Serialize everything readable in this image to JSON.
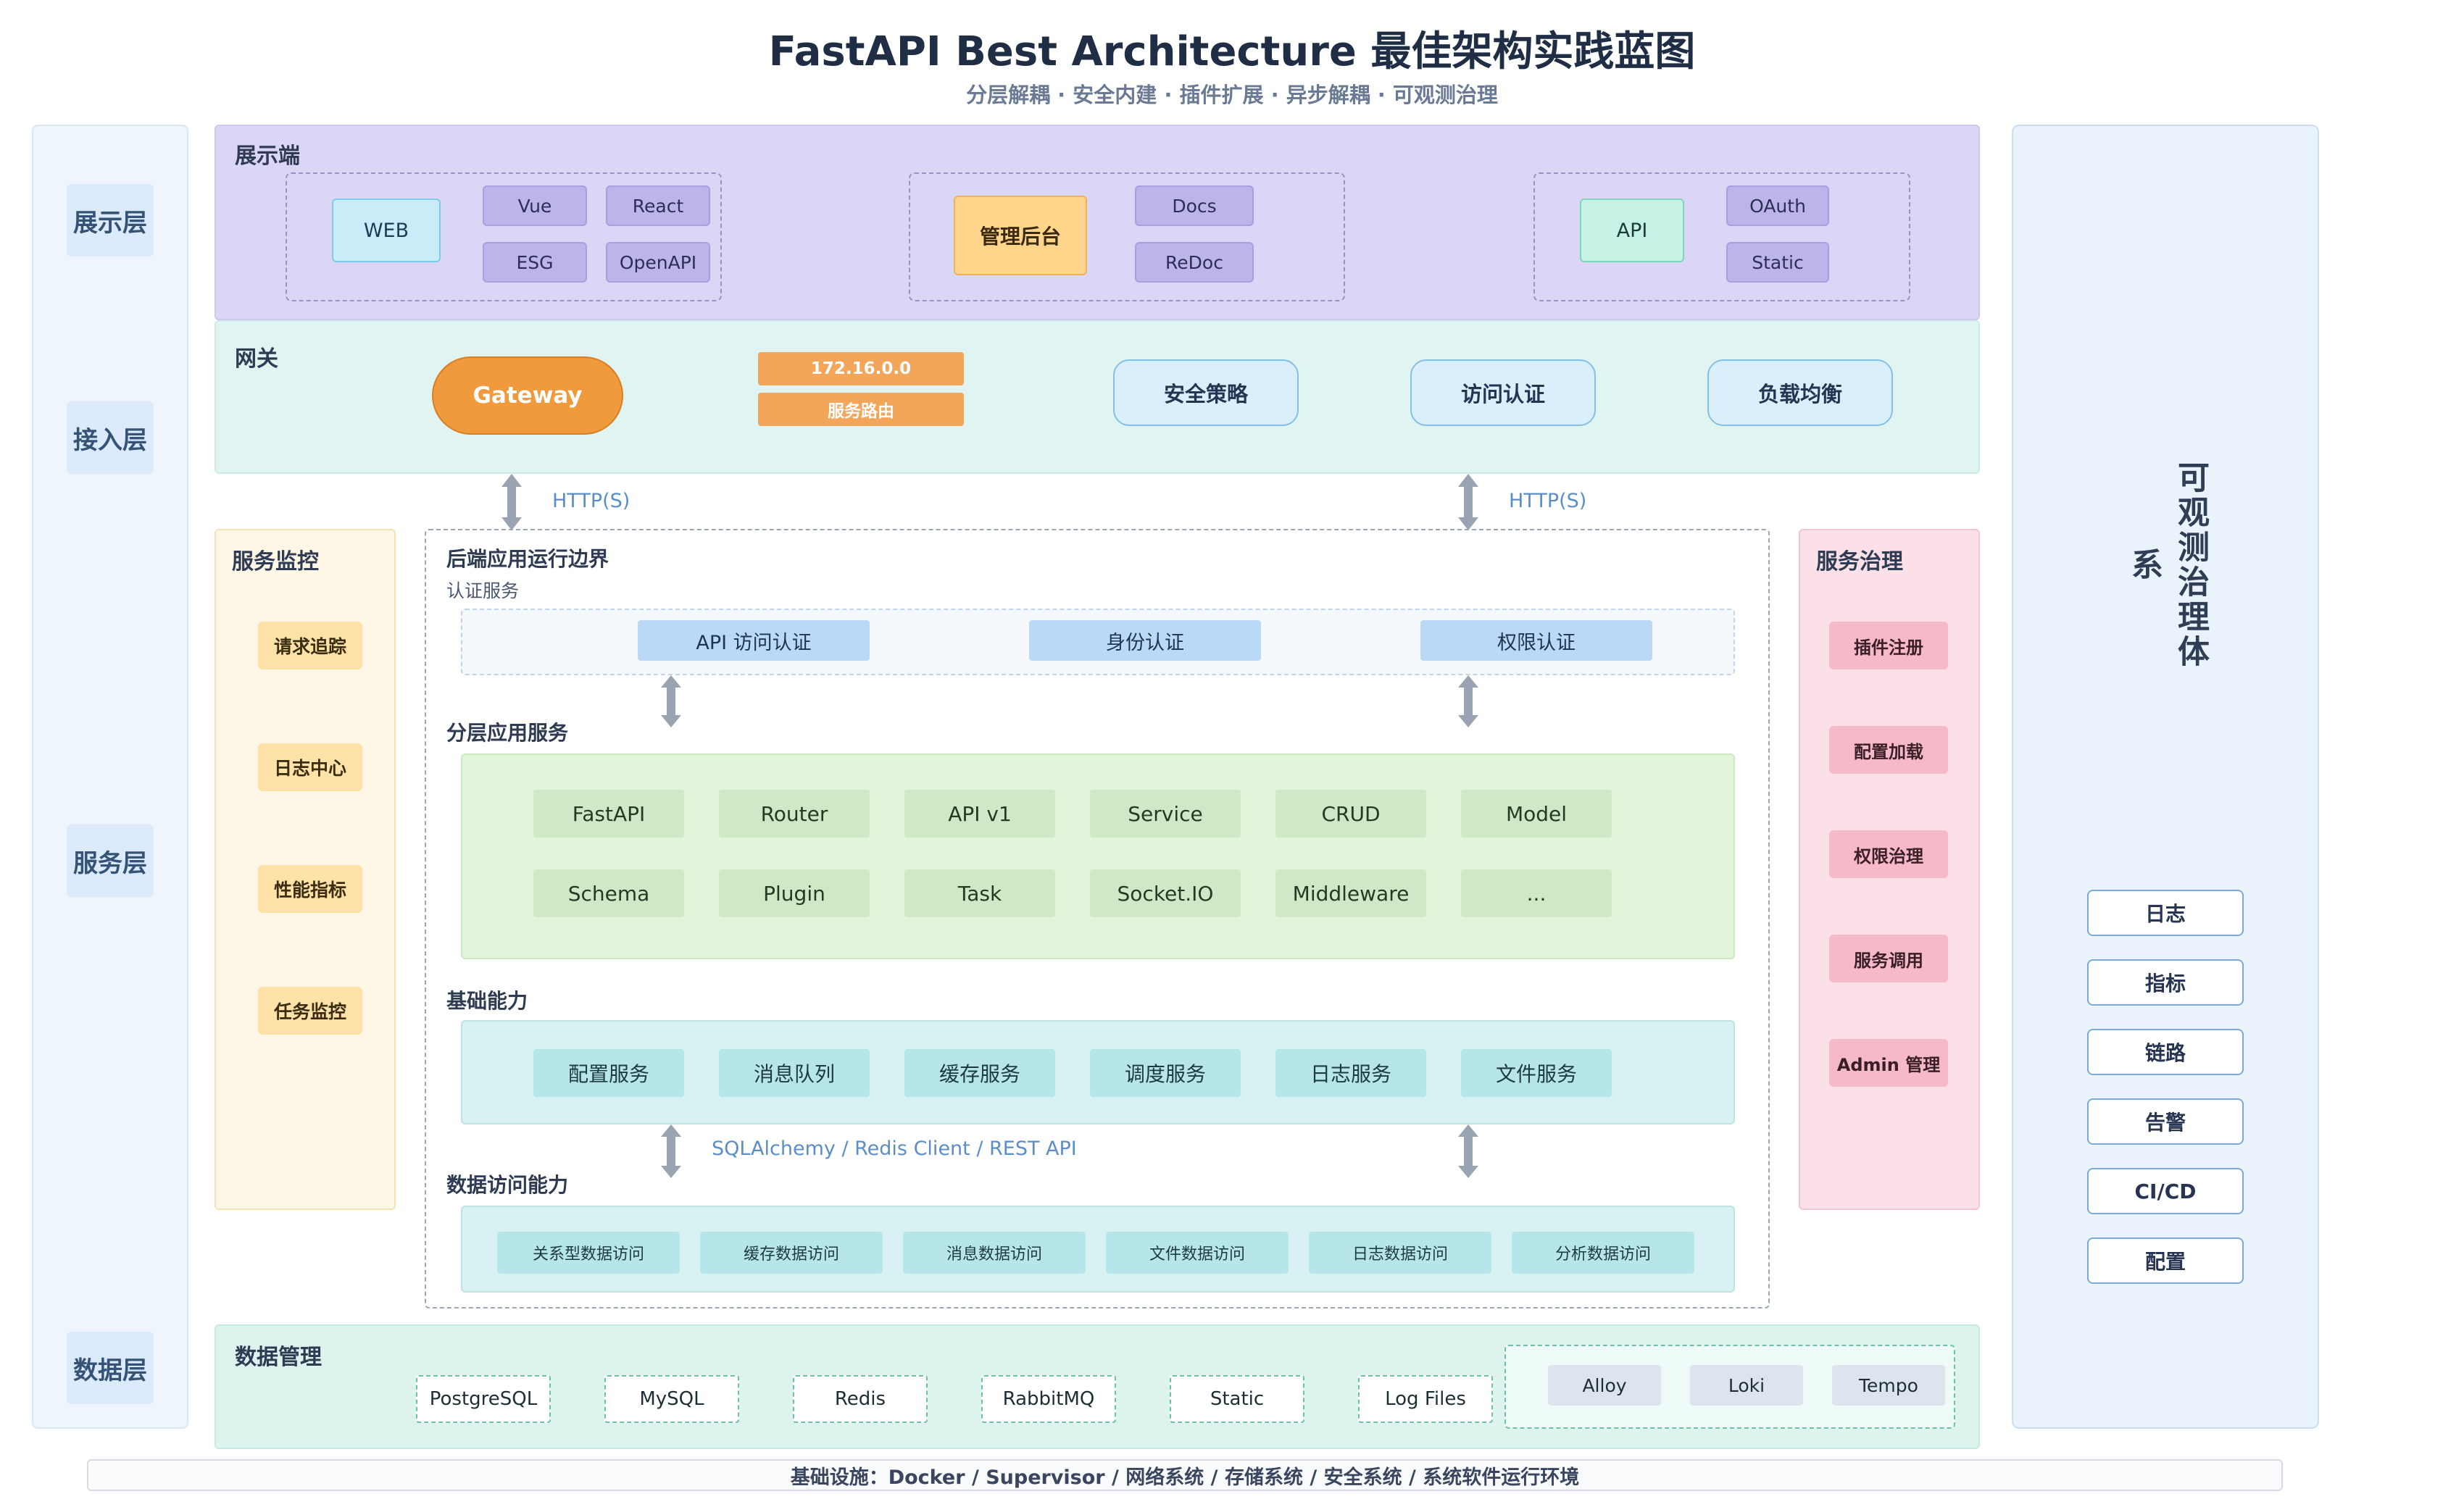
{
  "title": "FastAPI Best Architecture 最佳架构实践蓝图",
  "subtitle": "分层解耦 · 安全内建 · 插件扩展 · 异步解耦 · 可观测治理",
  "layers": {
    "presentation": "展示层",
    "access": "接入层",
    "service": "服务层",
    "data": "数据层"
  },
  "presentation": {
    "label": "展示端",
    "web": {
      "main": "WEB",
      "chips": [
        "Vue",
        "React",
        "ESG",
        "OpenAPI"
      ]
    },
    "admin": {
      "main": "管理后台",
      "chips": [
        "Docs",
        "ReDoc"
      ]
    },
    "api": {
      "main": "API",
      "chips": [
        "OAuth",
        "Static"
      ]
    }
  },
  "gateway": {
    "label": "网关",
    "main": "Gateway",
    "ip": "172.16.0.0",
    "routing": "服务路由",
    "pills": [
      "安全策略",
      "访问认证",
      "负载均衡"
    ]
  },
  "http_labels": [
    "HTTP(S)",
    "HTTP(S)"
  ],
  "monitoring": {
    "label": "服务监控",
    "items": [
      "请求追踪",
      "日志中心",
      "性能指标",
      "任务监控"
    ]
  },
  "governance": {
    "label": "服务治理",
    "items": [
      "插件注册",
      "配置加载",
      "权限治理",
      "服务调用",
      "Admin 管理"
    ]
  },
  "backend": {
    "label": "后端应用运行边界",
    "auth": {
      "label": "认证服务",
      "items": [
        "API 访问认证",
        "身份认证",
        "权限认证"
      ]
    },
    "layered": {
      "label": "分层应用服务",
      "row1": [
        "FastAPI",
        "Router",
        "API v1",
        "Service",
        "CRUD",
        "Model"
      ],
      "row2": [
        "Schema",
        "Plugin",
        "Task",
        "Socket.IO",
        "Middleware",
        "..."
      ]
    },
    "base": {
      "label": "基础能力",
      "items": [
        "配置服务",
        "消息队列",
        "缓存服务",
        "调度服务",
        "日志服务",
        "文件服务"
      ]
    },
    "data_access_note": "SQLAlchemy / Redis Client / REST API",
    "data_access": {
      "label": "数据访问能力",
      "items": [
        "关系型数据访问",
        "缓存数据访问",
        "消息数据访问",
        "文件数据访问",
        "日志数据访问",
        "分析数据访问"
      ]
    }
  },
  "data_management": {
    "label": "数据管理",
    "stores": [
      "PostgreSQL",
      "MySQL",
      "Redis",
      "RabbitMQ",
      "Static",
      "Log Files"
    ],
    "tools": [
      "Alloy",
      "Loki",
      "Tempo"
    ]
  },
  "observability": {
    "title": "可观测治理体系",
    "items": [
      "日志",
      "指标",
      "链路",
      "告警",
      "CI/CD",
      "配置"
    ]
  },
  "infrastructure": "基础设施：Docker / Supervisor / 网络系统 / 存储系统 / 安全系统 / 系统软件运行环境"
}
